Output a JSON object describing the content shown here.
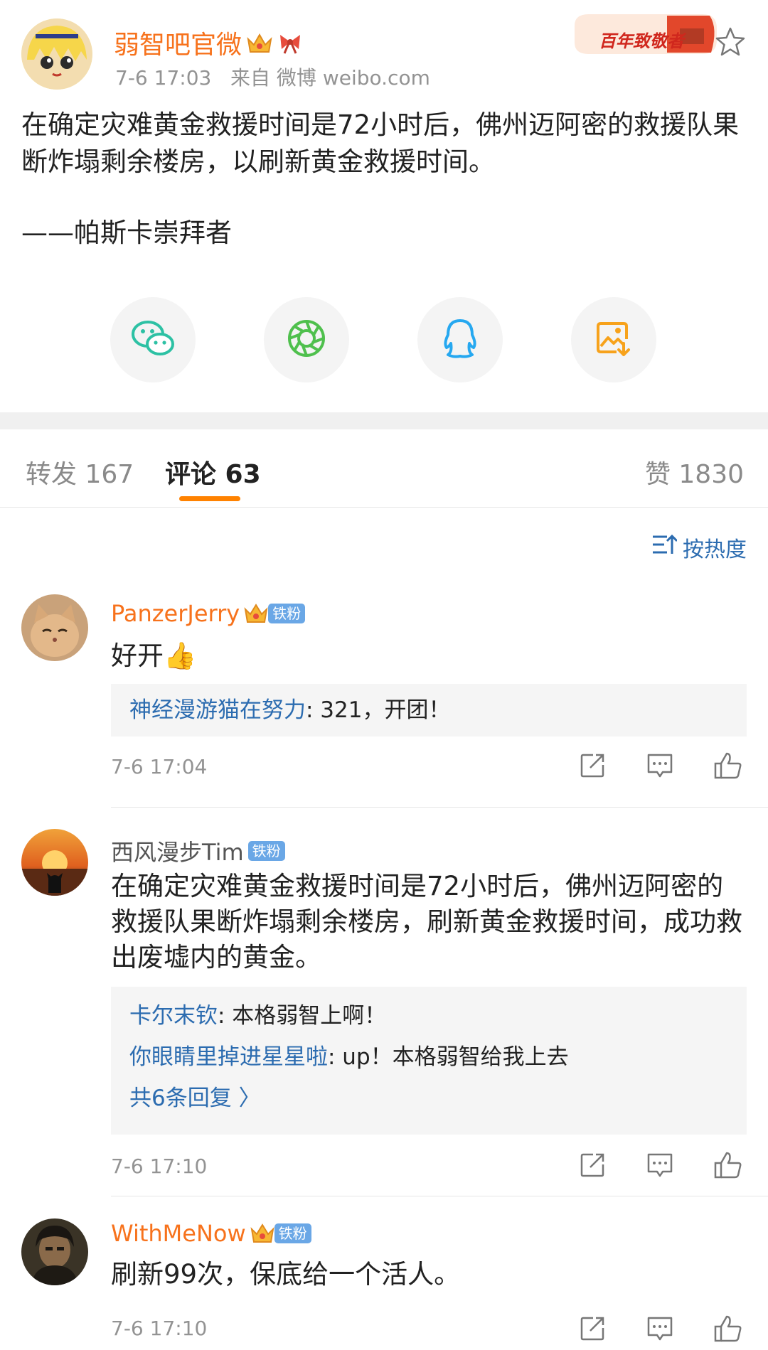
{
  "post": {
    "author": "弱智吧官微",
    "time": "7-6 17:03",
    "source": "来自 微博 weibo.com",
    "promo": "百年致敬者",
    "paragraphs": [
      "在确定灾难黄金救援时间是72小时后，佛州迈阿密的救援队果断炸塌剩余楼房，以刷新黄金救援时间。",
      "——帕斯卡崇拜者"
    ]
  },
  "share": {
    "items": [
      "wechat-icon",
      "moments-icon",
      "qq-icon",
      "save-image-icon"
    ]
  },
  "tabs": {
    "repost": "转发 167",
    "comments": "评论 63",
    "likes": "赞 1830"
  },
  "sort": {
    "label": "按热度"
  },
  "comments": [
    {
      "user": "PanzerJerry",
      "badge": "铁粉",
      "text": "好开👍",
      "replies": [
        {
          "user": "神经漫游猫在努力",
          "text": ": 321，开团！"
        }
      ],
      "time": "7-6 17:04"
    },
    {
      "user": "西风漫步Tim",
      "badge": "铁粉",
      "text": "在确定灾难黄金救援时间是72小时后，佛州迈阿密的救援队果断炸塌剩余楼房，刷新黄金救援时间，成功救出废墟内的黄金。",
      "replies": [
        {
          "user": "卡尔末钦",
          "text": ": 本格弱智上啊！"
        },
        {
          "user": "你眼睛里掉进星星啦",
          "text": ": up！本格弱智给我上去"
        }
      ],
      "more": "共6条回复 〉",
      "time": "7-6 17:10"
    },
    {
      "user": "WithMeNow",
      "badge": "铁粉",
      "text": "刷新99次，保底给一个活人。",
      "time": "7-6 17:10"
    }
  ],
  "colors": {
    "accent": "#ff8200",
    "username_orange": "#f7721c",
    "link_blue": "#2c6cb0",
    "badge_blue": "#6aa7e6"
  }
}
